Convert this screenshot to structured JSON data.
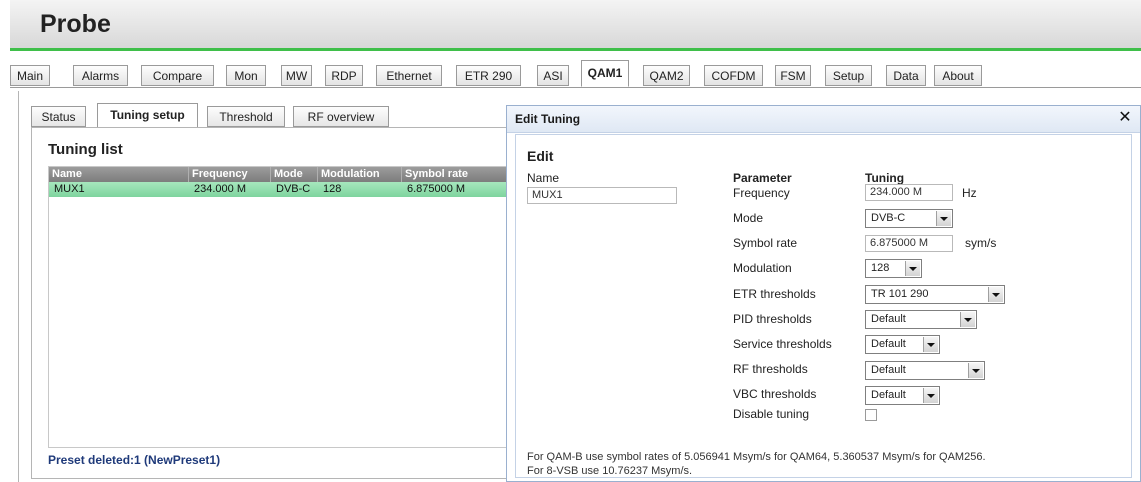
{
  "app": {
    "title": "Probe"
  },
  "main_tabs": [
    {
      "label": "Main"
    },
    {
      "label": "Alarms"
    },
    {
      "label": "Compare"
    },
    {
      "label": "Mon"
    },
    {
      "label": "MW"
    },
    {
      "label": "RDP"
    },
    {
      "label": "Ethernet"
    },
    {
      "label": "ETR 290"
    },
    {
      "label": "ASI"
    },
    {
      "label": "QAM1",
      "active": true
    },
    {
      "label": "QAM2"
    },
    {
      "label": "COFDM"
    },
    {
      "label": "FSM"
    },
    {
      "label": "Setup"
    },
    {
      "label": "Data"
    },
    {
      "label": "About"
    }
  ],
  "sub_tabs": [
    {
      "label": "Status"
    },
    {
      "label": "Tuning setup",
      "active": true
    },
    {
      "label": "Threshold"
    },
    {
      "label": "RF overview"
    }
  ],
  "tuning_list": {
    "title": "Tuning list",
    "columns": [
      "Name",
      "Frequency",
      "Mode",
      "Modulation",
      "Symbol rate"
    ],
    "rows": [
      {
        "name": "MUX1",
        "frequency": "234.000 M",
        "mode": "DVB-C",
        "modulation": "128",
        "symbol_rate": "6.875000 M",
        "selected": true
      }
    ]
  },
  "status_message": "Preset deleted:1 (NewPreset1)",
  "dialog": {
    "title": "Edit Tuning",
    "close_symbol": "✕",
    "heading": "Edit",
    "name_label": "Name",
    "name_value": "MUX1",
    "param_header": "Parameter",
    "tuning_header": "Tuning",
    "frequency_label": "Frequency",
    "frequency_value": "234.000 M",
    "frequency_unit": "Hz",
    "mode_label": "Mode",
    "mode_value": "DVB-C",
    "symbol_rate_label": "Symbol rate",
    "symbol_rate_value": "6.875000 M",
    "symbol_rate_unit": "sym/s",
    "modulation_label": "Modulation",
    "modulation_value": "128",
    "etr_label": "ETR thresholds",
    "etr_value": "TR 101 290",
    "pid_label": "PID thresholds",
    "pid_value": "Default",
    "service_label": "Service thresholds",
    "service_value": "Default",
    "rf_label": "RF thresholds",
    "rf_value": "Default",
    "vbc_label": "VBC thresholds",
    "vbc_value": "Default",
    "disable_label": "Disable tuning",
    "disable_checked": false,
    "note_line1": "For QAM-B use symbol rates of 5.056941 Msym/s for QAM64, 5.360537 Msym/s for QAM256.",
    "note_line2": "For 8-VSB use 10.76237 Msym/s."
  },
  "colors": {
    "accent_green": "#3fbf4a",
    "selected_row": "#8fdcab",
    "status_text": "#1f3a7a"
  }
}
